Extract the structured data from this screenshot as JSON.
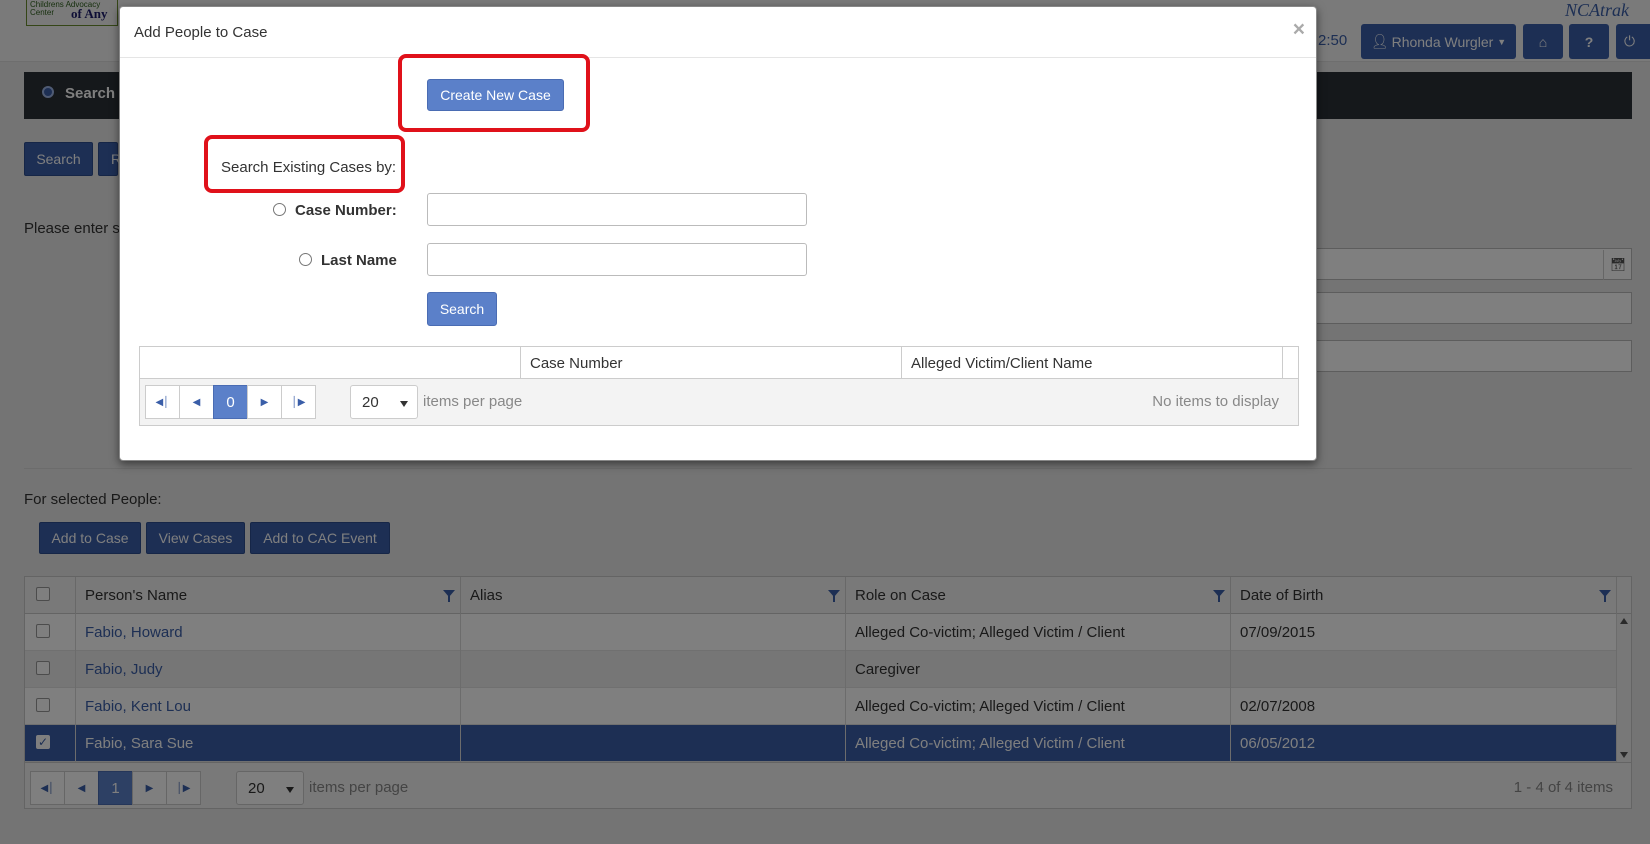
{
  "topbar": {
    "logo_small": "Childrens Advocacy Center",
    "logo_big": "of Any",
    "clock": "2:50",
    "user_name": "Rhonda Wurgler",
    "brand": "NCAtrak"
  },
  "background": {
    "search_tab_label": "Search",
    "search_button": "Search",
    "r_button": "R",
    "please_text": "Please enter s",
    "for_selected_label": "For selected People:",
    "actions": {
      "add_to_case": "Add to Case",
      "view_cases": "View Cases",
      "add_to_cac_event": "Add to CAC Event"
    },
    "grid": {
      "columns": [
        "Person's Name",
        "Alias",
        "Role on Case",
        "Date of Birth"
      ],
      "rows": [
        {
          "name": "Fabio, Howard",
          "alias": "",
          "role": "Alleged Co-victim; Alleged Victim / Client",
          "dob": "07/09/2015",
          "checked": false
        },
        {
          "name": "Fabio, Judy",
          "alias": "",
          "role": "Caregiver",
          "dob": "",
          "checked": false
        },
        {
          "name": "Fabio, Kent Lou",
          "alias": "",
          "role": "Alleged Co-victim; Alleged Victim / Client",
          "dob": "02/07/2008",
          "checked": false
        },
        {
          "name": "Fabio, Sara Sue",
          "alias": "",
          "role": "Alleged Co-victim; Alleged Victim / Client",
          "dob": "06/05/2012",
          "checked": true
        }
      ],
      "pager": {
        "current_page": "1",
        "page_size": "20",
        "per_page_label": "items per page",
        "info": "1 - 4 of 4 items"
      }
    }
  },
  "modal": {
    "title": "Add People to Case",
    "close_glyph": "×",
    "create_new_case": "Create New Case",
    "search_existing_label": "Search Existing Cases by:",
    "case_number_label": "Case Number:",
    "last_name_label": "Last Name",
    "case_number_value": "",
    "last_name_value": "",
    "search_button": "Search",
    "results_grid": {
      "columns": [
        "",
        "Case Number",
        "Alleged Victim/Client Name"
      ],
      "pager": {
        "current_page": "0",
        "page_size": "20",
        "per_page_label": "items per page",
        "info": "No items to display"
      }
    }
  },
  "colors": {
    "primary": "#3a5ea8",
    "button": "#5b80c9",
    "highlight_box": "#e0111a",
    "selected_row": "#3a5ea8"
  },
  "icons": [
    "user-icon",
    "caret-down-icon",
    "home-icon",
    "help-icon",
    "power-icon",
    "calendar-icon",
    "filter-icon",
    "first-page-icon",
    "prev-page-icon",
    "next-page-icon",
    "last-page-icon",
    "close-icon"
  ]
}
